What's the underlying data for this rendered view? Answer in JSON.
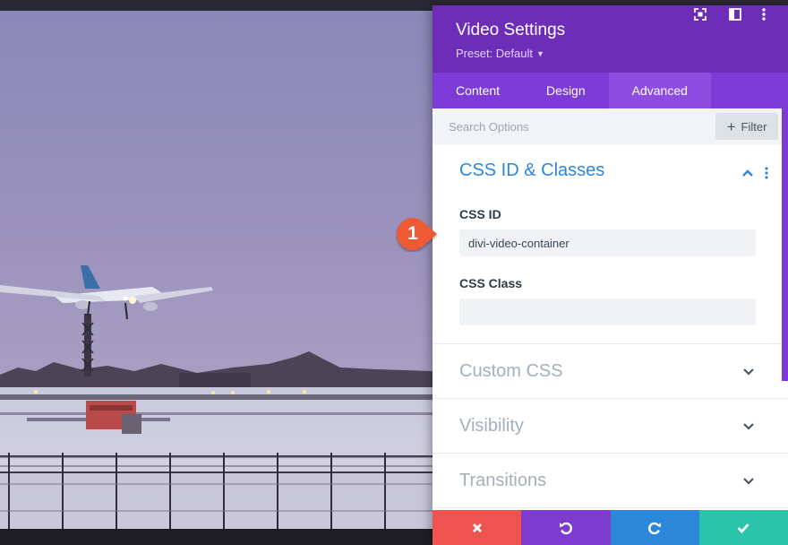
{
  "panel": {
    "title": "Video Settings",
    "preset": "Preset: Default",
    "header_icons": [
      "expand-icon",
      "split-view-icon",
      "more-vertical-icon"
    ]
  },
  "tabs": [
    {
      "label": "Content",
      "active": false
    },
    {
      "label": "Design",
      "active": false
    },
    {
      "label": "Advanced",
      "active": true
    }
  ],
  "search": {
    "placeholder": "Search Options",
    "filter_label": "Filter"
  },
  "css_section": {
    "title": "CSS ID & Classes",
    "css_id_label": "CSS ID",
    "css_id_value": "divi-video-container",
    "css_class_label": "CSS Class",
    "css_class_value": ""
  },
  "sections": [
    {
      "title": "Custom CSS"
    },
    {
      "title": "Visibility"
    },
    {
      "title": "Transitions"
    }
  ],
  "footer": {
    "buttons": [
      {
        "icon": "close-icon",
        "color": "#ef5350"
      },
      {
        "icon": "undo-icon",
        "color": "#7e3bd0"
      },
      {
        "icon": "redo-icon",
        "color": "#2b87da"
      },
      {
        "icon": "check-icon",
        "color": "#29c4a9"
      }
    ]
  },
  "callout": {
    "number": "1",
    "color": "#ee5a34"
  },
  "colors": {
    "header": "#6c2eb9",
    "tabs": "#7c3bd6",
    "active_tab": "#8c4de0",
    "section_title_active": "#2b87da",
    "section_title_muted": "#a3afbb"
  }
}
